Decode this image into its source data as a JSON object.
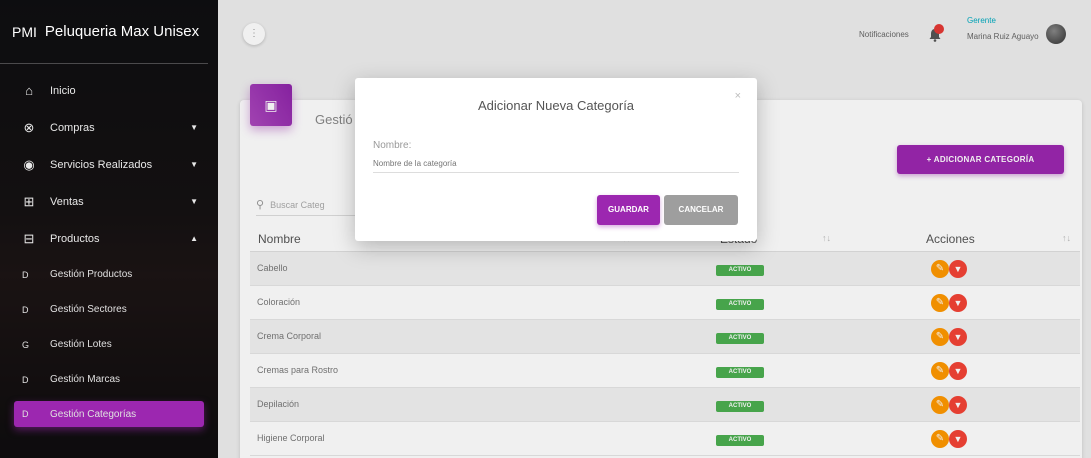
{
  "app": {
    "abbr": "PMI",
    "title": "Peluqueria Max Unisex"
  },
  "sidebar": {
    "items": [
      {
        "label": "Inicio",
        "icon": "home-icon"
      },
      {
        "label": "Compras",
        "icon": "cart-off-icon"
      },
      {
        "label": "Servicios Realizados",
        "icon": "eye-icon"
      },
      {
        "label": "Ventas",
        "icon": "cart-icon"
      },
      {
        "label": "Productos",
        "icon": "cart-outline-icon"
      }
    ],
    "subitems": [
      {
        "bullet": "D",
        "label": "Gestión Productos"
      },
      {
        "bullet": "D",
        "label": "Gestión Sectores"
      },
      {
        "bullet": "G",
        "label": "Gestión Lotes"
      },
      {
        "bullet": "D",
        "label": "Gestión Marcas"
      },
      {
        "bullet": "D",
        "label": "Gestión Categorías"
      }
    ]
  },
  "header": {
    "menu_icon": "⋮",
    "notifications_label": "Notificaciones",
    "role": "Gerente",
    "user_name": "Marina Ruiz Aguayo"
  },
  "card": {
    "title": "Gestió",
    "add_button": "+ ADICIONAR CATEGORÍA",
    "search_placeholder": "Buscar Categ"
  },
  "table": {
    "columns": [
      "Nombre",
      "Estado",
      "Acciones"
    ],
    "rows": [
      {
        "name": "Cabello",
        "status": "ACTIVO"
      },
      {
        "name": "Coloración",
        "status": "ACTIVO"
      },
      {
        "name": "Crema Corporal",
        "status": "ACTIVO"
      },
      {
        "name": "Cremas para Rostro",
        "status": "ACTIVO"
      },
      {
        "name": "Depilación",
        "status": "ACTIVO"
      },
      {
        "name": "Higiene Corporal",
        "status": "ACTIVO"
      }
    ]
  },
  "modal": {
    "title": "Adicionar Nueva Categoría",
    "close": "×",
    "field_label": "Nombre:",
    "field_placeholder": "Nombre de la categoría",
    "field_value": "",
    "save_label": "GUARDAR",
    "cancel_label": "CANCELAR"
  },
  "colors": {
    "accent": "#9c27b0",
    "success": "#4caf50",
    "warning": "#ff9800",
    "danger": "#f44336"
  }
}
